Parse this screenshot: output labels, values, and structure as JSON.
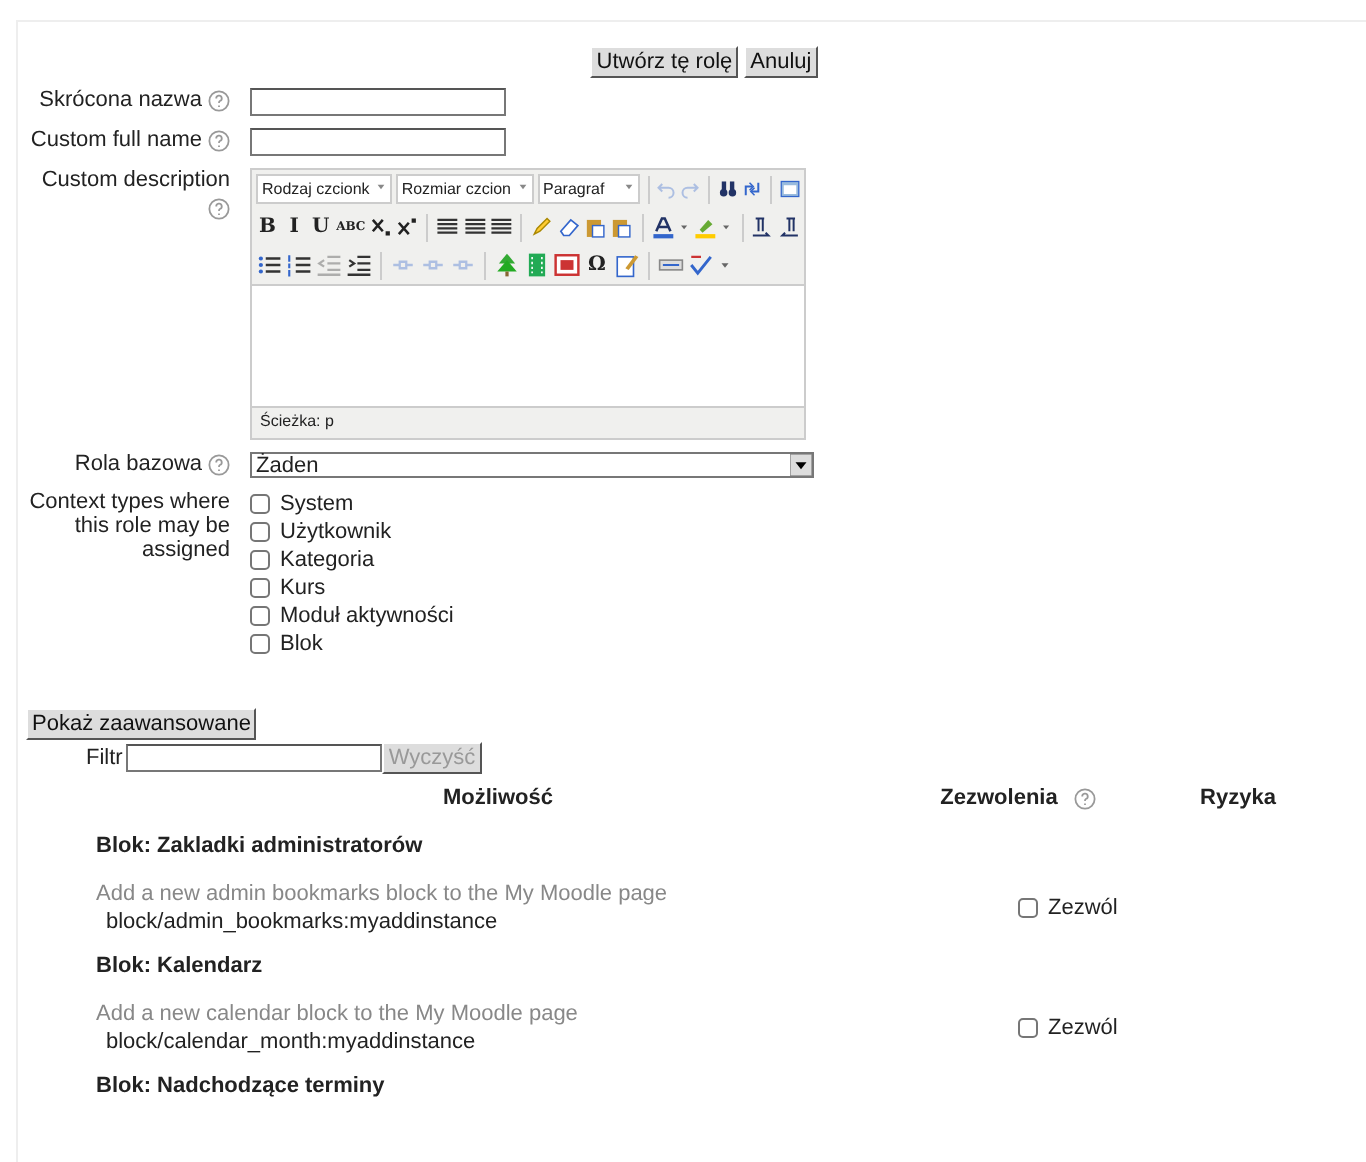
{
  "actions": [
    {
      "label": "Utwórz tę rolę"
    },
    {
      "label": "Anuluj"
    }
  ],
  "fields": [
    {
      "kind": "text",
      "label": "Skrócona nazwa",
      "help": true
    },
    {
      "kind": "text",
      "label": "Custom full name",
      "help": true
    },
    {
      "kind": "editor",
      "label": "Custom description",
      "help": true
    },
    {
      "kind": "select",
      "label": "Rola bazowa",
      "help": true,
      "value": "Żaden"
    },
    {
      "kind": "checkboxes",
      "label": "Context types where this role may be assigned",
      "help": false
    }
  ],
  "editor": {
    "toolbar": [
      [
        {
          "kind": "select",
          "label": "Rodzaj czcionk"
        },
        {
          "kind": "select",
          "label": "Rozmiar czcion"
        },
        {
          "kind": "select",
          "label": "Paragraf"
        },
        {
          "kind": "sep"
        },
        {
          "kind": "undo",
          "disabled": true
        },
        {
          "kind": "redo",
          "disabled": true
        },
        {
          "kind": "sep"
        },
        {
          "kind": "find",
          "disabled": false
        },
        {
          "kind": "replace",
          "disabled": false
        },
        {
          "kind": "sep"
        },
        {
          "kind": "fullscreen",
          "disabled": false
        }
      ],
      [
        {
          "kind": "text",
          "label": "B",
          "disabled": false
        },
        {
          "kind": "text",
          "label": "I",
          "disabled": false
        },
        {
          "kind": "text",
          "label": "U",
          "disabled": false
        },
        {
          "kind": "text",
          "label": "ABC",
          "disabled": false
        },
        {
          "kind": "subscript",
          "disabled": false
        },
        {
          "kind": "superscript",
          "disabled": false
        },
        {
          "kind": "sep"
        },
        {
          "kind": "align",
          "disabled": false
        },
        {
          "kind": "align",
          "disabled": false
        },
        {
          "kind": "align",
          "disabled": false
        },
        {
          "kind": "sep"
        },
        {
          "kind": "pencil",
          "disabled": false
        },
        {
          "kind": "eraser",
          "disabled": false
        },
        {
          "kind": "paste",
          "disabled": false
        },
        {
          "kind": "paste",
          "disabled": false
        },
        {
          "kind": "sep"
        },
        {
          "kind": "textcolor",
          "disabled": false
        },
        {
          "kind": "highlight",
          "disabled": false
        },
        {
          "kind": "sep"
        },
        {
          "kind": "ltr",
          "disabled": false
        },
        {
          "kind": "rtl",
          "disabled": false
        }
      ],
      [
        {
          "kind": "bullets",
          "disabled": false
        },
        {
          "kind": "numbers",
          "disabled": false
        },
        {
          "kind": "outdent",
          "disabled": true
        },
        {
          "kind": "indent",
          "disabled": false
        },
        {
          "kind": "sep"
        },
        {
          "kind": "link",
          "disabled": true
        },
        {
          "kind": "link",
          "disabled": true
        },
        {
          "kind": "link",
          "disabled": true
        },
        {
          "kind": "sep"
        },
        {
          "kind": "image",
          "disabled": false
        },
        {
          "kind": "media",
          "disabled": false
        },
        {
          "kind": "embed",
          "disabled": false
        },
        {
          "kind": "text",
          "label": "Ω",
          "disabled": false
        },
        {
          "kind": "edit",
          "disabled": false
        },
        {
          "kind": "sep"
        },
        {
          "kind": "html",
          "disabled": false
        },
        {
          "kind": "spell",
          "disabled": false
        }
      ]
    ],
    "path": "Ścieżka: p"
  },
  "contexts": [
    {
      "label": "System",
      "checked": false
    },
    {
      "label": "Użytkownik",
      "checked": false
    },
    {
      "label": "Kategoria",
      "checked": false
    },
    {
      "label": "Kurs",
      "checked": false
    },
    {
      "label": "Moduł aktywności",
      "checked": false
    },
    {
      "label": "Blok",
      "checked": false
    }
  ],
  "advanced_button": "Pokaż zaawansowane",
  "filter": {
    "label": "Filtr",
    "clear": "Wyczyść",
    "clear_disabled": true
  },
  "table": {
    "columns": [
      {
        "label": "Możliwość",
        "help": false
      },
      {
        "label": "Zezwolenia",
        "help": true
      },
      {
        "label": "Ryzyka",
        "help": false
      }
    ],
    "groups": [
      {
        "title": "Blok: Zakladki administratorów",
        "rows": [
          {
            "description": "Add a new admin bookmarks block to the My Moodle page",
            "capability": "block/admin_bookmarks:myaddinstance",
            "label": "Zezwól",
            "checked": false
          }
        ]
      },
      {
        "title": "Blok: Kalendarz",
        "rows": [
          {
            "description": "Add a new calendar block to the My Moodle page",
            "capability": "block/calendar_month:myaddinstance",
            "label": "Zezwól",
            "checked": false
          }
        ]
      },
      {
        "title": "Blok: Nadchodzące terminy"
      }
    ]
  }
}
